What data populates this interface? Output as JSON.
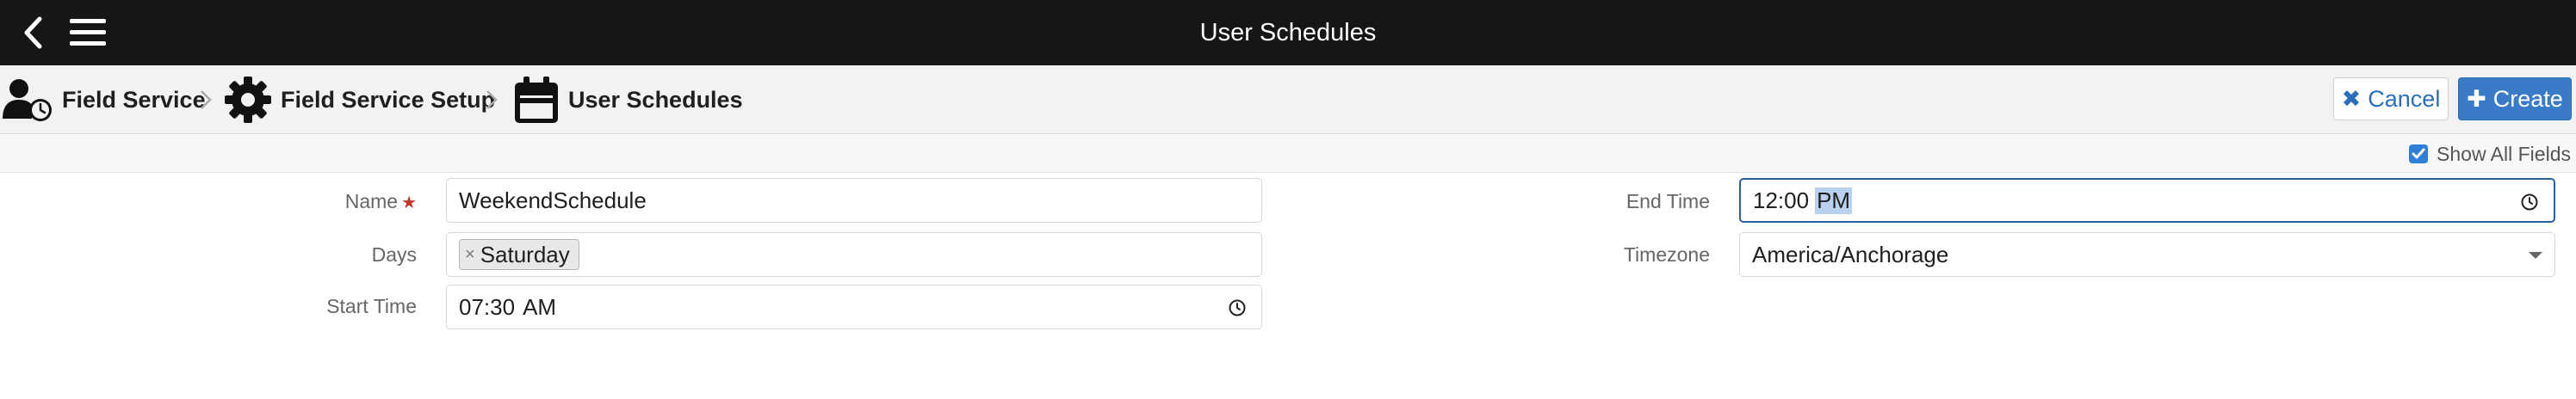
{
  "header": {
    "title": "User Schedules"
  },
  "breadcrumb": [
    {
      "label": "Field Service",
      "icon": "user-clock-icon"
    },
    {
      "label": "Field Service Setup",
      "icon": "gear-icon"
    },
    {
      "label": "User Schedules",
      "icon": "calendar-icon"
    }
  ],
  "actions": {
    "cancel_label": "Cancel",
    "create_label": "Create"
  },
  "options": {
    "show_all_fields_label": "Show All Fields",
    "show_all_fields_checked": true
  },
  "form": {
    "name": {
      "label": "Name",
      "value": "WeekendSchedule",
      "required": true
    },
    "days": {
      "label": "Days",
      "tags": [
        "Saturday"
      ]
    },
    "start_time": {
      "label": "Start Time",
      "hour_min": "07:30",
      "ampm": "AM"
    },
    "end_time": {
      "label": "End Time",
      "hour_min": "12:00",
      "ampm": "PM"
    },
    "timezone": {
      "label": "Timezone",
      "value": "America/Anchorage"
    }
  },
  "colors": {
    "topbar": "#161616",
    "accent": "#3a7bc8",
    "required": "#c0392b"
  }
}
